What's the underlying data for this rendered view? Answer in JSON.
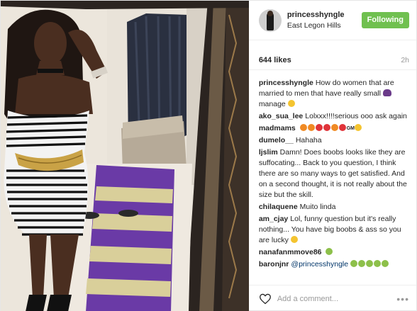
{
  "post": {
    "username": "princesshyngle",
    "location": "East Legon Hills",
    "follow_label": "Following",
    "likes": "644 likes",
    "time": "2h",
    "add_comment_placeholder": "Add a comment...",
    "more_label": "•••",
    "follow_color": "#70c050"
  },
  "comments": [
    {
      "user": "princesshyngle",
      "text": "How do women that are married to men that have really small",
      "emoji_after": [
        "purple"
      ],
      "text2": "manage",
      "emoji_end": [
        "yellow"
      ]
    },
    {
      "user": "ako_sua_lee",
      "text": "Lolxxx!!!!serious ooo ask again"
    },
    {
      "user": "madmams",
      "text": "",
      "emoji_row": [
        "orange",
        "orange",
        "red",
        "red",
        "orange",
        "red",
        "gm",
        "yellow"
      ]
    },
    {
      "user": "dumelo__",
      "text": "Hahaha"
    },
    {
      "user": "ljslim",
      "text": "Damn! Does boobs looks like they are suffocating... Back to you question, I think there are so many ways to get satisfied. And on a second thought, it is not really about the size but the skill."
    },
    {
      "user": "chilaquene",
      "text": "Muito linda"
    },
    {
      "user": "am_cjay",
      "text": "Lol, funny question but it's really nothing... You have big boobs & ass so you are lucky",
      "emoji_end": [
        "yellow"
      ]
    },
    {
      "user": "nanafanmmove86",
      "text": "",
      "emoji_row": [
        "green"
      ]
    },
    {
      "user": "baronjnr",
      "text": "@princesshyngle",
      "emoji_row": [
        "green",
        "green",
        "green",
        "green",
        "green"
      ]
    }
  ],
  "icons": [
    "heart-icon",
    "more-options-icon",
    "avatar"
  ]
}
